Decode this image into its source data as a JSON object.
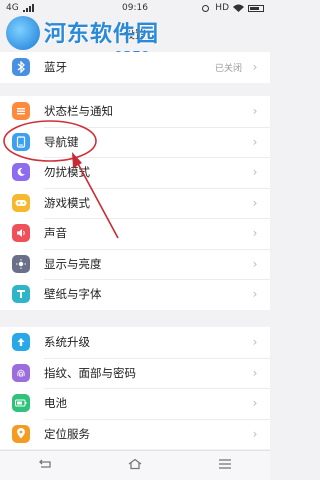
{
  "status_bar": {
    "network": "4G",
    "time": "09:16",
    "hd": "HD"
  },
  "header": {
    "title": "设置"
  },
  "watermark": {
    "site_name": "河东软件园",
    "url": "www.pc0359.cn"
  },
  "groups": [
    {
      "items": [
        {
          "label": "蓝牙",
          "value": "已关闭",
          "icon": "bluetooth-icon",
          "color": "#4a90e2"
        }
      ]
    },
    {
      "items": [
        {
          "label": "状态栏与通知",
          "icon": "status-bar-icon",
          "color": "#ff8a3d"
        },
        {
          "label": "导航键",
          "icon": "navigation-keys-icon",
          "color": "#3ba0f0"
        },
        {
          "label": "勿扰模式",
          "icon": "moon-icon",
          "color": "#8e6cf0"
        },
        {
          "label": "游戏模式",
          "icon": "gamepad-icon",
          "color": "#f5b82e"
        },
        {
          "label": "声音",
          "icon": "speaker-icon",
          "color": "#f0505a"
        },
        {
          "label": "显示与亮度",
          "icon": "brightness-icon",
          "color": "#6a6f8a"
        },
        {
          "label": "壁纸与字体",
          "icon": "wallpaper-icon",
          "color": "#2eb6c8"
        }
      ]
    },
    {
      "items": [
        {
          "label": "系统升级",
          "icon": "upgrade-icon",
          "color": "#29a8e8"
        },
        {
          "label": "指纹、面部与密码",
          "icon": "fingerprint-icon",
          "color": "#9b6ee0"
        },
        {
          "label": "电池",
          "icon": "battery-icon",
          "color": "#2fc27a"
        },
        {
          "label": "定位服务",
          "icon": "location-icon",
          "color": "#f59a23"
        }
      ]
    }
  ],
  "nav_bar": {
    "back": "back-icon",
    "home": "home-icon",
    "menu": "menu-icon"
  },
  "annotation": {
    "highlight_color": "#d0303a",
    "arrow_color": "#c82a33"
  }
}
